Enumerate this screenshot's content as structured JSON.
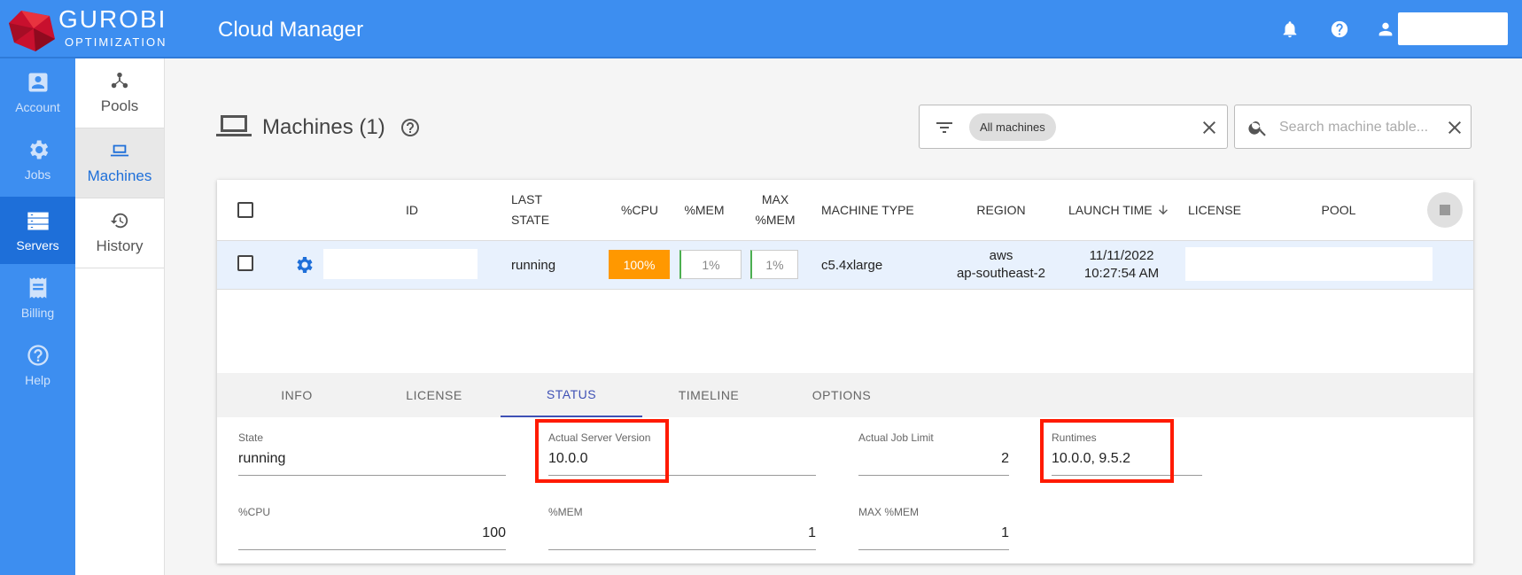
{
  "header": {
    "brand_name": "GUROBI",
    "brand_sub": "OPTIMIZATION",
    "app_title": "Cloud Manager"
  },
  "rail": [
    {
      "label": "Account",
      "icon": "account-icon"
    },
    {
      "label": "Jobs",
      "icon": "gear-icon"
    },
    {
      "label": "Servers",
      "icon": "servers-icon",
      "active": true
    },
    {
      "label": "Billing",
      "icon": "billing-icon"
    },
    {
      "label": "Help",
      "icon": "help-icon"
    }
  ],
  "subnav": [
    {
      "label": "Pools",
      "icon": "pools-icon"
    },
    {
      "label": "Machines",
      "icon": "laptop-icon",
      "active": true
    },
    {
      "label": "History",
      "icon": "history-icon"
    }
  ],
  "page": {
    "title": "Machines (1)",
    "filter_chip": "All machines",
    "search_placeholder": "Search machine table..."
  },
  "table": {
    "headers": {
      "id": "ID",
      "last_state_1": "LAST",
      "last_state_2": "STATE",
      "cpu": "%CPU",
      "mem": "%MEM",
      "max_mem_1": "MAX",
      "max_mem_2": "%MEM",
      "machine_type": "MACHINE TYPE",
      "region": "REGION",
      "launch_time": "LAUNCH TIME",
      "license": "LICENSE",
      "pool": "POOL"
    },
    "rows": [
      {
        "state": "running",
        "cpu": "100%",
        "mem": "1%",
        "max_mem": "1%",
        "machine_type": "c5.4xlarge",
        "region_1": "aws",
        "region_2": "ap-southeast-2",
        "launch_1": "11/11/2022",
        "launch_2": "10:27:54 AM"
      }
    ]
  },
  "tabs": [
    "INFO",
    "LICENSE",
    "STATUS",
    "TIMELINE",
    "OPTIONS"
  ],
  "status": {
    "state_label": "State",
    "state_value": "running",
    "server_version_label": "Actual Server Version",
    "server_version_value": "10.0.0",
    "job_limit_label": "Actual Job Limit",
    "job_limit_value": "2",
    "runtimes_label": "Runtimes",
    "runtimes_value": "10.0.0, 9.5.2",
    "cpu_label": "%CPU",
    "cpu_value": "100",
    "mem_label": "%MEM",
    "mem_value": "1",
    "max_mem_label": "MAX %MEM",
    "max_mem_value": "1"
  },
  "colors": {
    "header_blue": "#3d8ef0",
    "rail_active": "#1e6fd9",
    "cpu_orange": "#ff9800",
    "tab_active": "#3f51b5",
    "highlight_red": "#ff1a00"
  }
}
